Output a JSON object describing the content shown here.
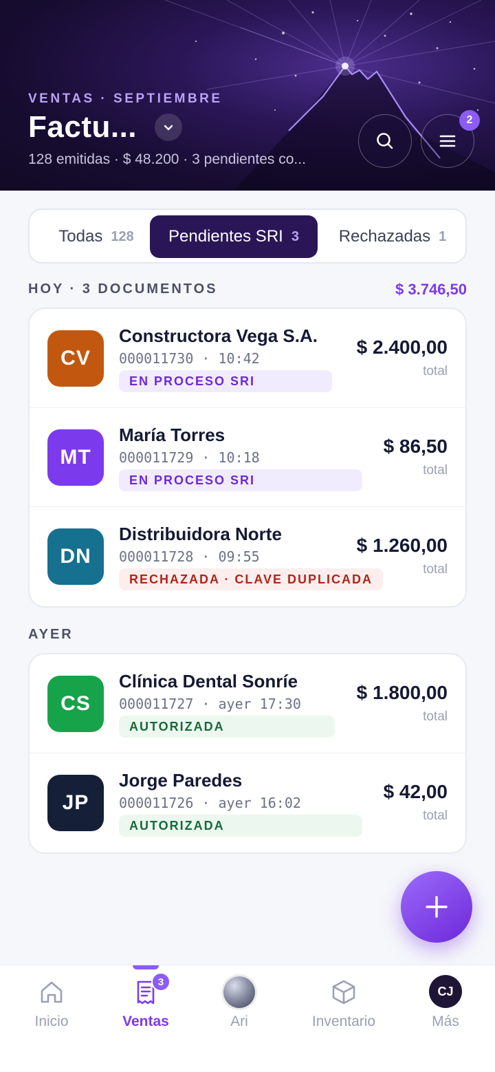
{
  "header": {
    "eyebrow": "VENTAS · SEPTIEMBRE",
    "title": "Factu...",
    "subtitle": "128 emitidas · $ 48.200 · 3 pendientes co...",
    "menu_badge": "2",
    "icons": [
      "chevron-down-icon",
      "search-icon",
      "menu-icon"
    ]
  },
  "tabs": [
    {
      "label": "Todas",
      "count": "128",
      "active": false
    },
    {
      "label": "Pendientes SRI",
      "count": "3",
      "active": true
    },
    {
      "label": "Rechazadas",
      "count": "1",
      "active": false
    }
  ],
  "sections": [
    {
      "label": "HOY · 3 DOCUMENTOS",
      "total": "$ 3.746,50",
      "items": [
        {
          "initials": "CV",
          "avatar_color": "#c2580f",
          "name": "Constructora Vega S.A.",
          "meta": "000011730 · 10:42",
          "status": "EN PROCESO SRI",
          "status_kind": "proc",
          "amount": "$ 2.400,00",
          "amount_sub": "total"
        },
        {
          "initials": "MT",
          "avatar_color": "#7c3aed",
          "name": "María Torres",
          "meta": "000011729 · 10:18",
          "status": "EN PROCESO SRI",
          "status_kind": "proc",
          "amount": "$ 86,50",
          "amount_sub": "total"
        },
        {
          "initials": "DN",
          "avatar_color": "#15718f",
          "name": "Distribuidora Norte",
          "meta": "000011728 · 09:55",
          "status": "RECHAZADA · CLAVE DUPLICADA",
          "status_kind": "rej",
          "amount": "$ 1.260,00",
          "amount_sub": "total"
        }
      ]
    },
    {
      "label": "AYER",
      "items": [
        {
          "initials": "CS",
          "avatar_color": "#16a34a",
          "name": "Clínica Dental Sonríe",
          "meta": "000011727 · ayer 17:30",
          "status": "AUTORIZADA",
          "status_kind": "ok",
          "amount": "$ 1.800,00",
          "amount_sub": "total"
        },
        {
          "initials": "JP",
          "avatar_color": "#152038",
          "name": "Jorge Paredes",
          "meta": "000011726 · ayer 16:02",
          "status": "AUTORIZADA",
          "status_kind": "ok",
          "amount": "$ 42,00",
          "amount_sub": "total"
        }
      ]
    }
  ],
  "fab": {
    "icon": "plus-icon"
  },
  "bottom_nav": {
    "items": [
      {
        "label": "Inicio",
        "icon": "home-icon",
        "active": false
      },
      {
        "label": "Ventas",
        "icon": "receipt-icon",
        "active": true,
        "badge": "3"
      },
      {
        "label": "Ari",
        "icon": "orb-icon",
        "active": false
      },
      {
        "label": "Inventario",
        "icon": "box-icon",
        "active": false
      },
      {
        "label": "Más",
        "icon": "avatar",
        "active": false,
        "initials": "CJ"
      }
    ]
  },
  "colors": {
    "accent": "#7c3aed",
    "header_bg": "#1a0f36",
    "active_tab": "#2a1656",
    "status_processing": "#6d28d9",
    "status_rejected": "#b42318",
    "status_authorized": "#17693a"
  }
}
